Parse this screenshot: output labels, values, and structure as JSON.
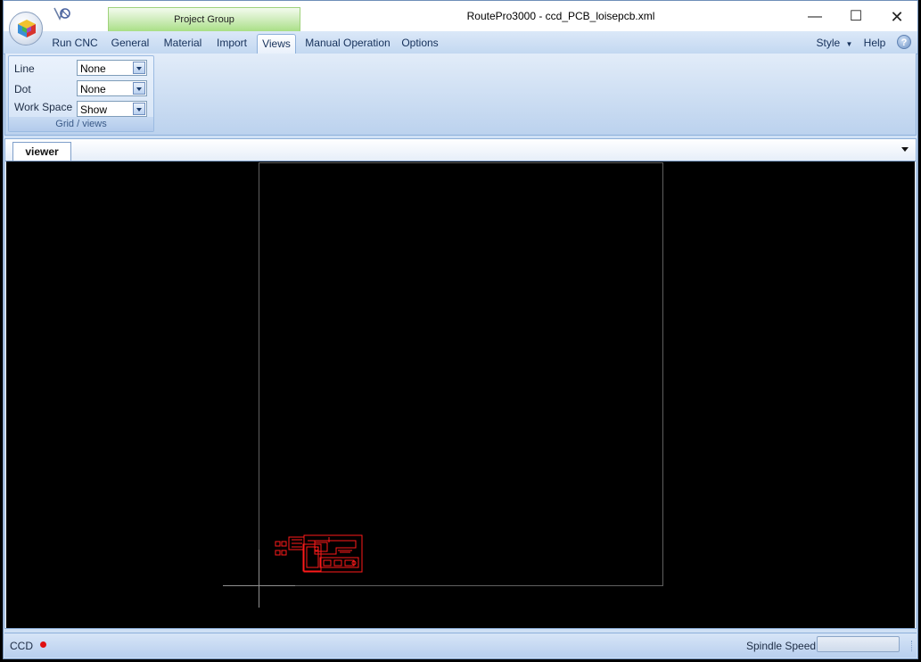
{
  "window": {
    "title": "RoutePro3000 - ccd_PCB_loisepcb.xml",
    "controls": {
      "minimize": "—",
      "maximize": "☐",
      "close": "✕"
    }
  },
  "contextual_tab_group": "Project Group",
  "ribbon": {
    "tabs": [
      {
        "label": "Run CNC",
        "active": false
      },
      {
        "label": "General",
        "active": false
      },
      {
        "label": "Material",
        "active": false
      },
      {
        "label": "Import",
        "active": false
      },
      {
        "label": "Views",
        "active": true
      },
      {
        "label": "Manual Operation",
        "active": false
      },
      {
        "label": "Options",
        "active": false
      }
    ],
    "style_label": "Style",
    "help_label": "Help",
    "help_icon_glyph": "?"
  },
  "grid_views": {
    "caption": "Grid / views",
    "rows": [
      {
        "label": "Line",
        "value": "None"
      },
      {
        "label": "Dot",
        "value": "None"
      },
      {
        "label": "Work Space",
        "value": "Show"
      }
    ]
  },
  "viewer": {
    "tab_label": "viewer",
    "background_color": "#000000",
    "workspace_outline_color": "#606060",
    "pcb_color": "#ff1a1a"
  },
  "status": {
    "ccd_label": "CCD",
    "ccd_indicator_color": "#e01010",
    "spindle_label": "Spindle Speed",
    "spindle_value": ""
  }
}
